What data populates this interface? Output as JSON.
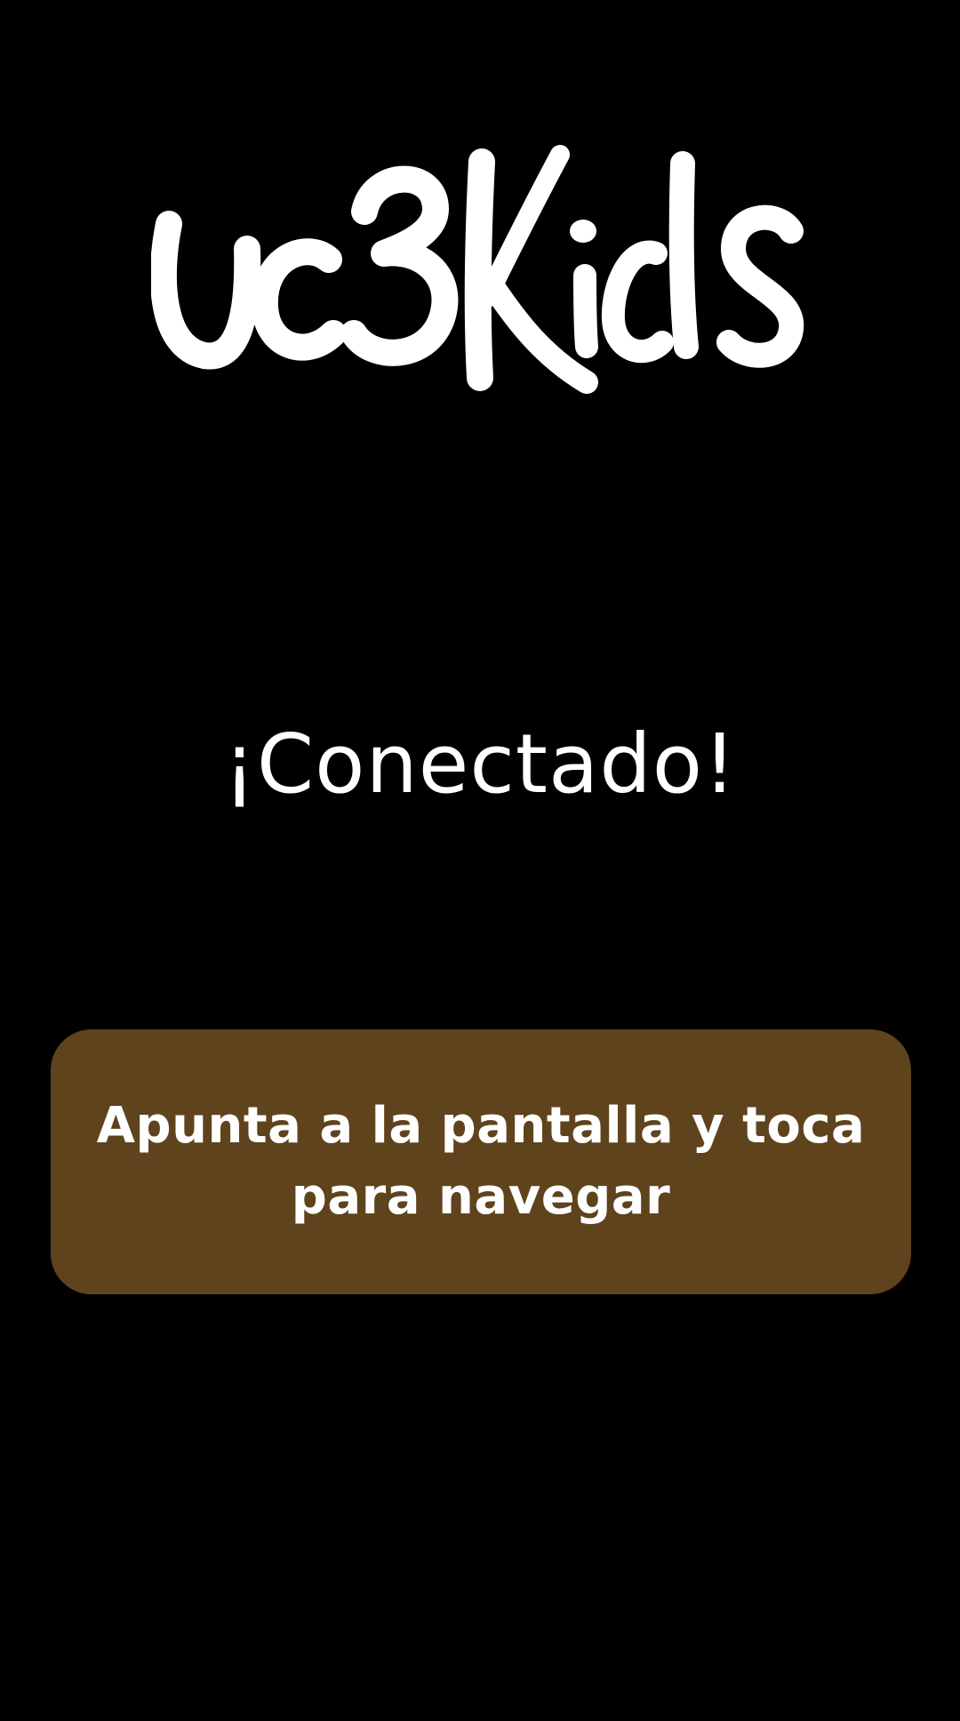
{
  "app": {
    "logo_text": "uc3Kids"
  },
  "status": {
    "text": "¡Conectado!"
  },
  "instruction": {
    "text": "Apunta a la pantalla y toca para navegar"
  },
  "colors": {
    "background": "#000000",
    "card": "#5f431c",
    "text": "#ffffff"
  }
}
